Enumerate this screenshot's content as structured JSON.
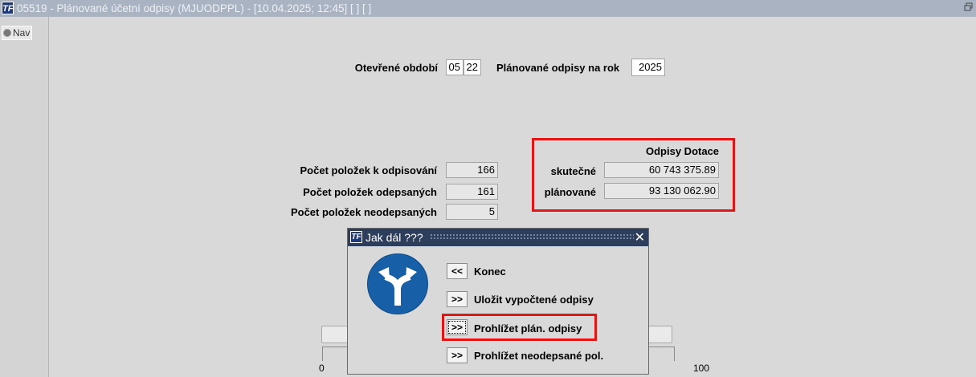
{
  "window": {
    "title": "05519 - Plánované účetní odpisy (MJUODPPL) - [10.04.2025; 12:45]  [  ]  [  ]",
    "app_icon": "TF",
    "restore_icon": "restore-window-icon"
  },
  "nav": {
    "label": "Nav"
  },
  "header": {
    "open_period_label": "Otevřené období",
    "period_month": "05",
    "period_year": "22",
    "planned_year_label": "Plánované odpisy na rok",
    "planned_year": "2025"
  },
  "counts": {
    "to_write_off_label": "Počet položek k odpisování",
    "to_write_off": "166",
    "written_off_label": "Počet položek odepsaných",
    "written_off": "161",
    "not_written_off_label": "Počet položek neodepsaných",
    "not_written_off": "5"
  },
  "depreciation": {
    "heading": "Odpisy Dotace",
    "actual_label": "skutečné",
    "actual": "60 743 375.89",
    "planned_label": "plánované",
    "planned": "93 130 062.90"
  },
  "progress": {
    "min": "0",
    "max": "100"
  },
  "dialog": {
    "title": "Jak dál ???",
    "icon": "TF",
    "sign_icon": "split-arrow-sign-icon",
    "buttons": [
      {
        "glyph": "<<",
        "label": "Konec"
      },
      {
        "glyph": ">>",
        "label": "Uložit vypočtené odpisy"
      },
      {
        "glyph": ">>",
        "label": "Prohlížet plán. odpisy"
      },
      {
        "glyph": ">>",
        "label": "Prohlížet neodepsané pol."
      }
    ]
  },
  "colors": {
    "highlight": "#e31515",
    "titlebar": "#a9b3c2",
    "dialog_titlebar": "#2c3e5c",
    "sign": "#1760a8"
  }
}
